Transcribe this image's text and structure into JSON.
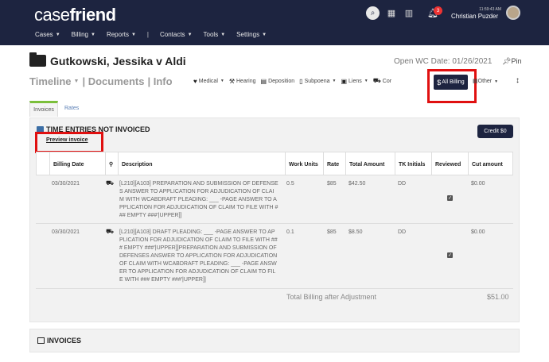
{
  "app": {
    "logo_light": "case",
    "logo_bold": "friend",
    "datetime": "11:59:43 AM",
    "user_name": "Christian Puzder",
    "notification_count": "3"
  },
  "nav": {
    "cases": "Cases",
    "billing": "Billing",
    "reports": "Reports",
    "separator": "|",
    "contacts": "Contacts",
    "tools": "Tools",
    "settings": "Settings"
  },
  "case": {
    "title": "Gutkowski, Jessika v Aldi",
    "open_date": "Open WC Date: 01/26/2021",
    "pin_label": "Pin"
  },
  "subnav": {
    "timeline": "Timeline",
    "documents": "| Documents",
    "info": "| Info"
  },
  "tools": {
    "medical": "Medical",
    "hearing": "Hearing",
    "deposition": "Deposition",
    "subpoena": "Subpoena",
    "liens": "Liens",
    "cor": "Cor",
    "all_billing": "All Billing",
    "other": "Other"
  },
  "tabs": {
    "invoices": "Invoices",
    "rates": "Rates"
  },
  "section": {
    "title": "TIME ENTRIES NOT INVOICED",
    "credit": "Credit $0",
    "preview": "Preview invoice"
  },
  "table": {
    "headers": {
      "billing_date": "Billing Date",
      "description": "Description",
      "work_units": "Work Units",
      "rate": "Rate",
      "total_amount": "Total Amount",
      "tk_initials": "TK Initials",
      "reviewed": "Reviewed",
      "cut_amount": "Cut amount"
    },
    "rows": [
      {
        "date": "03/30/2021",
        "description": "[L210][A103] PREPARATION AND SUBMISSION OF DEFENSES ANSWER TO APPLICATION FOR ADJUDICATION OF CLAIM WITH WCABDRAFT PLEADING: ___ -PAGE ANSWER TO APPLICATION FOR ADJUDICATION OF CLAIM TO FILE WITH ### EMPTY ###'|UPPER]]",
        "work_units": "0.5",
        "rate": "$85",
        "total": "$42.50",
        "initials": "DD",
        "cut": "$0.00"
      },
      {
        "date": "03/30/2021",
        "description": "[L210][A103] DRAFT PLEADING: ___ -PAGE ANSWER TO APPLICATION FOR ADJUDICATION OF CLAIM TO FILE WITH ### EMPTY ###'|UPPER]]PREPARATION AND SUBMISSION OF DEFENSES ANSWER TO APPLICATION FOR ADJUDICATION OF CLAIM WITH WCABDRAFT PLEADING: ___ -PAGE ANSWER TO APPLICATION FOR ADJUDICATION OF CLAIM TO FILE WITH ### EMPTY ###'|UPPER]]",
        "work_units": "0.1",
        "rate": "$85",
        "total": "$8.50",
        "initials": "DD",
        "cut": "$0.00"
      }
    ],
    "total_label": "Total Billing after Adjustment",
    "total_value": "$51.00"
  },
  "invoices": {
    "title": "INVOICES"
  }
}
